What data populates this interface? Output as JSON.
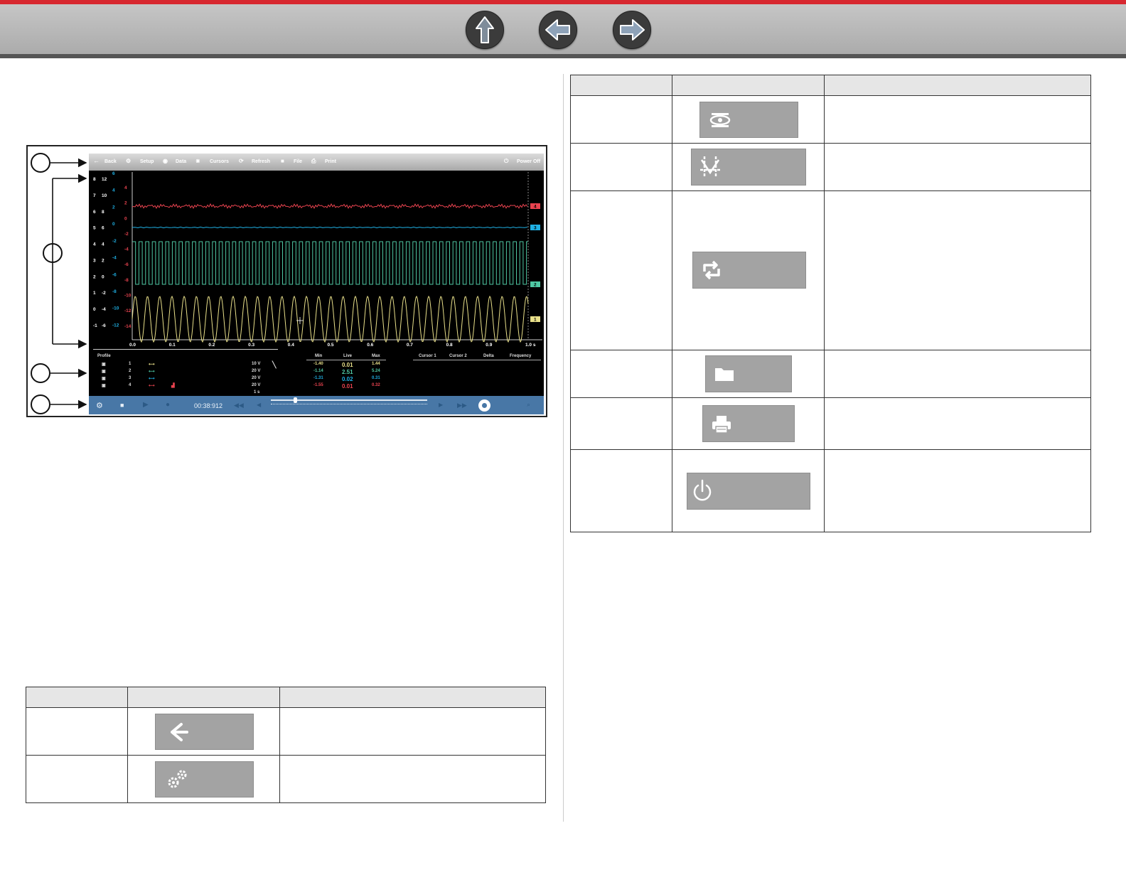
{
  "nav": {
    "up_icon": "up-arrow-icon",
    "back_icon": "left-arrow-icon",
    "forward_icon": "right-arrow-icon"
  },
  "screen": {
    "toolbar": {
      "back": "Back",
      "setup": "Setup",
      "data": "Data",
      "cursors": "Cursors",
      "refresh": "Refresh",
      "file": "File",
      "print": "Print",
      "power_off": "Power Off"
    },
    "y_axes": {
      "col1": [
        "8",
        "7",
        "6",
        "5",
        "4",
        "3",
        "2",
        "1",
        "0",
        "-1"
      ],
      "col2": [
        "12",
        "10",
        "8",
        "6",
        "4",
        "2",
        "0",
        "-2",
        "-4",
        "-6"
      ],
      "col3": [
        "6",
        "4",
        "2",
        "0",
        "-2",
        "-4",
        "-6",
        "-8",
        "-10",
        "-12"
      ],
      "col4": [
        "4",
        "2",
        "0",
        "-2",
        "-4",
        "-6",
        "-8",
        "-10",
        "-12",
        "-14"
      ]
    },
    "x_axis": [
      "0.0",
      "0.1",
      "0.2",
      "0.3",
      "0.4",
      "0.5",
      "0.6",
      "0.7",
      "0.8",
      "0.9",
      "1.0 s"
    ],
    "traces": [
      {
        "id": "4",
        "color": "#e8434f",
        "kind": "noisy-flat"
      },
      {
        "id": "3",
        "color": "#1fb0e4",
        "kind": "flat"
      },
      {
        "id": "2",
        "color": "#4fc9a4",
        "kind": "square"
      },
      {
        "id": "1",
        "color": "#e9e08a",
        "kind": "sine"
      }
    ],
    "data_headers": {
      "profile": "Profile",
      "min": "Min",
      "live": "Live",
      "max": "Max",
      "cursor1": "Cursor 1",
      "cursor2": "Cursor 2",
      "delta": "Delta",
      "frequency": "Frequency"
    },
    "rows": [
      {
        "ch": "1",
        "scale": "10 V",
        "min": "-1.40",
        "live": "0.01",
        "max": "1.44",
        "color": "#e9e08a"
      },
      {
        "ch": "2",
        "scale": "20 V",
        "min": "-1.14",
        "live": "2.51",
        "max": "5.24",
        "color": "#4fc9a4"
      },
      {
        "ch": "3",
        "scale": "20 V",
        "min": "-1.31",
        "live": "0.02",
        "max": "0.31",
        "color": "#1fb0e4"
      },
      {
        "ch": "4",
        "scale": "20 V",
        "min": "-1.55",
        "live": "0.01",
        "max": "0.32",
        "color": "#e8434f"
      }
    ],
    "sweep": "1 s",
    "time_readout": "00:38:912"
  },
  "left_table_rows": [
    {
      "icon": "left-arrow-icon"
    },
    {
      "icon": "gears-icon"
    }
  ],
  "right_table_rows": [
    {
      "icon": "eye-icon"
    },
    {
      "icon": "cursors-icon"
    },
    {
      "icon": "refresh-icon"
    },
    {
      "icon": "folder-icon"
    },
    {
      "icon": "printer-icon"
    },
    {
      "icon": "power-icon"
    }
  ],
  "colors": {
    "brand_red": "#d7282f",
    "playback_blue": "#4877a6"
  }
}
